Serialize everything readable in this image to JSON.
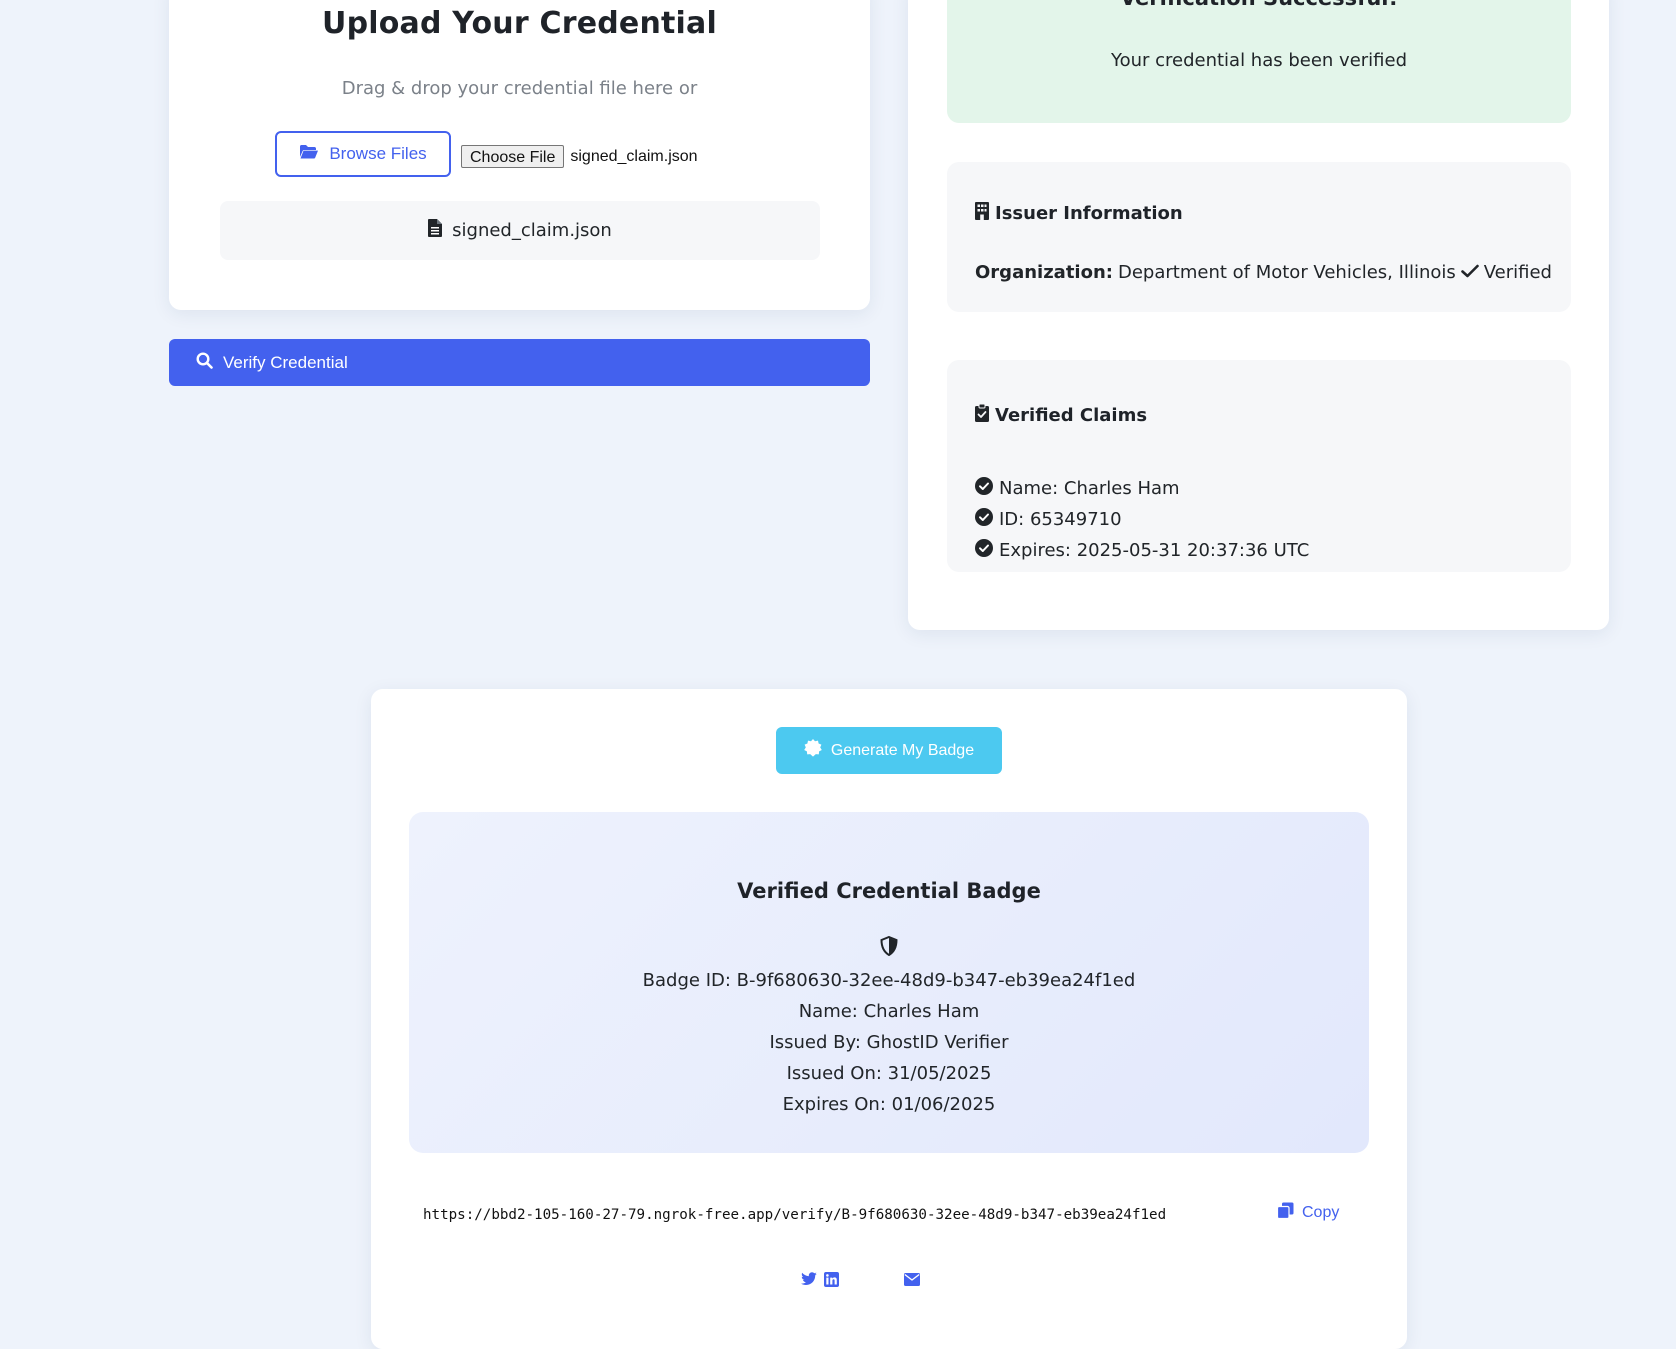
{
  "upload": {
    "title": "Upload Your Credential",
    "subtitle": "Drag & drop your credential file here or",
    "browse_label": "Browse Files",
    "choose_file_label": "Choose File",
    "selected_file": "signed_claim.json",
    "file_display_name": "signed_claim.json",
    "folder_icon": "folder-open-icon",
    "file_icon": "file-icon"
  },
  "verify_button": {
    "label": "Verify Credential",
    "icon": "search-icon"
  },
  "result": {
    "success_title": "Verification Successful!",
    "success_message": "Your credential has been verified",
    "issuer": {
      "heading": "Issuer Information",
      "org_label": "Organization:",
      "org_value": "Department of Motor Vehicles, Illinois",
      "verified_label": "Verified"
    },
    "claims": {
      "heading": "Verified Claims",
      "items": [
        "Name: Charles Ham",
        "ID: 65349710",
        "Expires: 2025-05-31 20:37:36 UTC"
      ]
    }
  },
  "badge": {
    "generate_label": "Generate My Badge",
    "title": "Verified Credential Badge",
    "badge_id_line": "Badge ID: B-9f680630-32ee-48d9-b347-eb39ea24f1ed",
    "name_line": "Name: Charles Ham",
    "issued_by_line": "Issued By: GhostID Verifier",
    "issued_on_line": "Issued On: 31/05/2025",
    "expires_on_line": "Expires On: 01/06/2025",
    "url": "https://bbd2-105-160-27-79.ngrok-free.app/verify/B-9f680630-32ee-48d9-b347-eb39ea24f1ed",
    "copy_label": "Copy",
    "share_icons": [
      "twitter-icon",
      "linkedin-icon",
      "envelope-icon"
    ]
  },
  "colors": {
    "primary": "#4361ee",
    "accent": "#4cc9f0",
    "success_bg": "#e3f5ea",
    "page_bg": "#eef3fb"
  }
}
